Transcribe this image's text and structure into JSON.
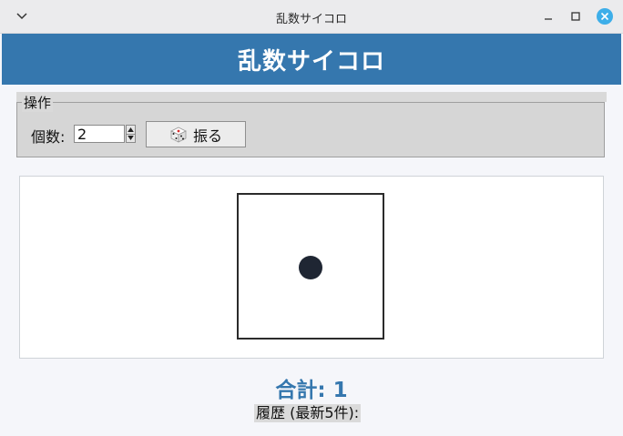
{
  "window": {
    "title": "乱数サイコロ",
    "accent_color": "#3577ae",
    "close_button_color": "#3daee9"
  },
  "header": {
    "title": "乱数サイコロ"
  },
  "controls": {
    "group_label": "操作",
    "count_label": "個数:",
    "count_value": "2",
    "roll_button_label": "振る",
    "roll_button_icon": "dice-icon"
  },
  "dice": [
    {
      "face_value": 1
    }
  ],
  "result": {
    "total_text": "合計: 1",
    "history_label": "履歴 (最新5件):"
  }
}
